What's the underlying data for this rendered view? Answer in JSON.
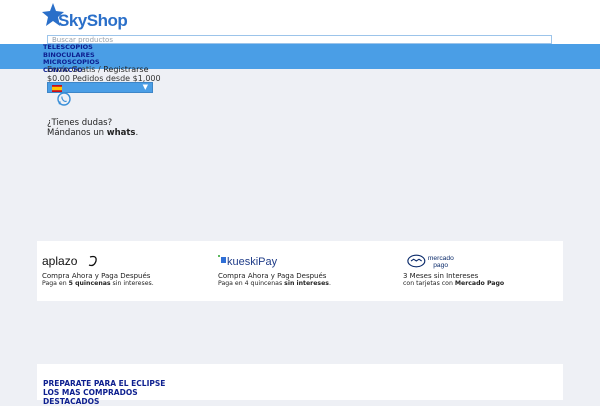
{
  "header": {
    "logo_text": "SkyShop",
    "search_placeholder": "Buscar productos"
  },
  "menu": {
    "items": [
      "TELESCOPIOS",
      "BINOCULARES",
      "MICROSCOPIOS",
      "CONTACTO"
    ]
  },
  "account": {
    "shipping_text": "Envío Gratis",
    "separator": " / ",
    "register": "Registrarse",
    "cart_amount": "$0.00",
    "free_shipping_note": "Pedidos desde $1,000"
  },
  "language": {
    "icon": "spain-flag-icon"
  },
  "help": {
    "question": "¿Tienes dudas?",
    "prefix": "Mándanos un ",
    "bold": "whats",
    "suffix": "."
  },
  "payments": [
    {
      "brand": "aplazo",
      "line1": "Compra Ahora y Paga Después",
      "line2_a": "Paga en ",
      "line2_b": "5 quincenas",
      "line2_c": " sin intereses."
    },
    {
      "brand": "kueskiPay",
      "line1": "Compra Ahora y Paga Después",
      "line2_a": "Paga en 4 quincenas ",
      "line2_b": "sin intereses",
      "line2_c": "."
    },
    {
      "brand": "mercado pago",
      "line1": "3 Meses sin Intereses",
      "line2_a": "con tarjetas con ",
      "line2_b": "Mercado Pago",
      "line2_c": ""
    }
  ],
  "promo": {
    "items": [
      "PREPARATE PARA EL ECLIPSE",
      "LOS MAS COMPRADOS",
      "DESTACADOS"
    ]
  },
  "colors": {
    "brand_blue": "#2a6fc9",
    "band_blue": "#4a9ee6",
    "nav_navy": "#0d1f8f"
  }
}
